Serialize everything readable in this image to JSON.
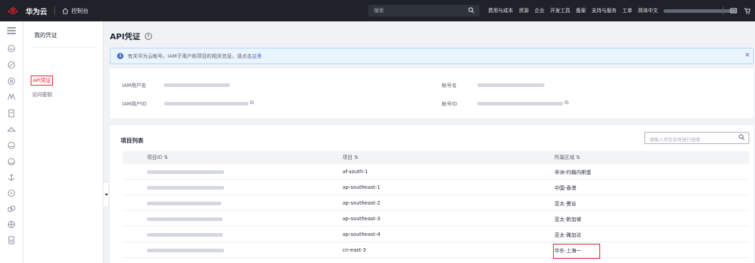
{
  "topbar": {
    "brand": "华为云",
    "console": "控制台",
    "search_placeholder": "搜索",
    "nav": [
      "费用与成本",
      "资源",
      "企业",
      "开发工具",
      "备案",
      "支持与服务",
      "工单",
      "简体中文"
    ]
  },
  "menu": {
    "title": "我的凭证",
    "items": [
      "API凭证",
      "访问密钥"
    ]
  },
  "page": {
    "title": "API凭证",
    "alert_text": "有关华为云帐号，IAM子用户和项目的相关信息，请点击",
    "alert_link": "这里"
  },
  "info": {
    "iam_user_label": "IAM用户名",
    "iam_id_label": "IAM用户ID",
    "account_label": "帐号名",
    "account_id_label": "帐号ID"
  },
  "projects": {
    "title": "项目列表",
    "search_placeholder": "请输入项目名称进行搜索",
    "columns": [
      "项目ID",
      "项目",
      "所属区域"
    ],
    "rows": [
      {
        "project": "af-south-1",
        "region": "非洲-约翰内斯堡"
      },
      {
        "project": "ap-southeast-1",
        "region": "中国-香港"
      },
      {
        "project": "ap-southeast-2",
        "region": "亚太-曼谷"
      },
      {
        "project": "ap-southeast-3",
        "region": "亚太-新加坡"
      },
      {
        "project": "ap-southeast-4",
        "region": "亚太-雅加达"
      },
      {
        "project": "cn-east-3",
        "region": "华东-上海一"
      }
    ]
  },
  "colors": {
    "accent": "#e41f2b",
    "link": "#526ecc",
    "topbar": "#1f2329"
  }
}
